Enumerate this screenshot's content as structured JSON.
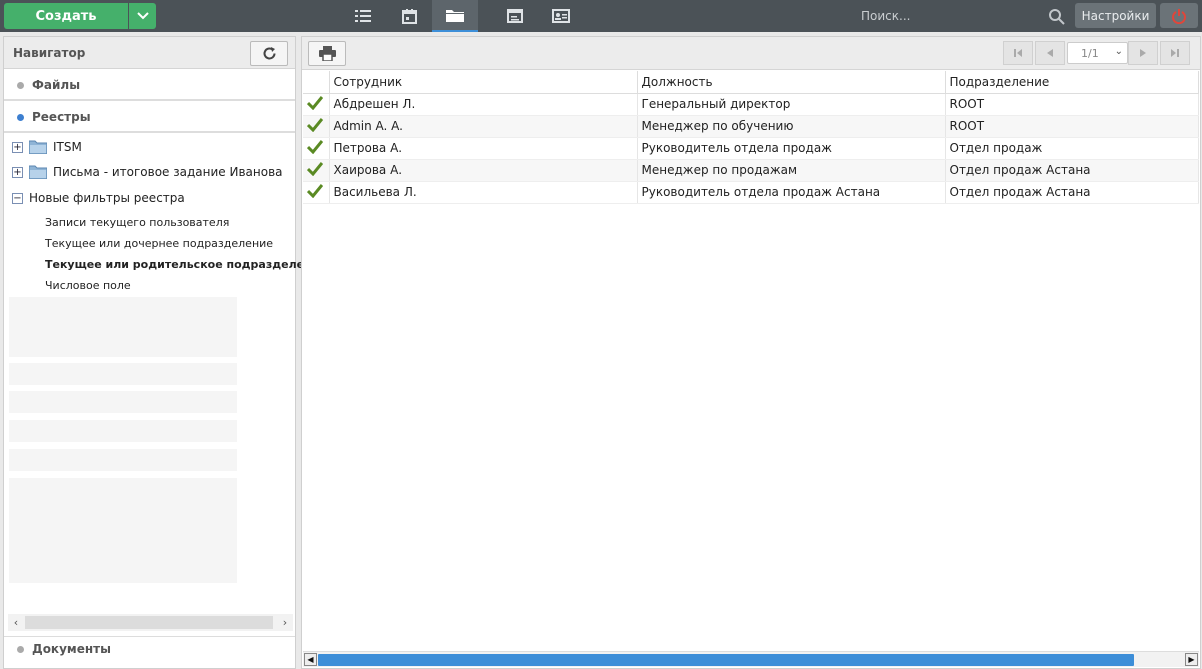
{
  "header": {
    "create_label": "Создать",
    "search_placeholder": "Поиск...",
    "settings_label": "Настройки",
    "icons": [
      "list-icon",
      "calendar-icon",
      "folder-icon",
      "browser-window-icon",
      "contact-card-icon"
    ]
  },
  "navigator": {
    "title": "Навигатор",
    "sections": {
      "files": "Файлы",
      "registries": "Реестры",
      "documents": "Документы"
    },
    "tree": [
      {
        "label": "ITSM"
      },
      {
        "label": "Письма - итоговое задание Иванова"
      },
      {
        "label": "Новые фильтры реестра"
      }
    ],
    "filters": [
      {
        "label": "Записи текущего пользователя"
      },
      {
        "label": "Текущее или дочернее подразделение"
      },
      {
        "label": "Текущее или родительское подразделение"
      },
      {
        "label": "Числовое поле"
      }
    ]
  },
  "pager": {
    "page": "1/1"
  },
  "table": {
    "columns": [
      "Сотрудник",
      "Должность",
      "Подразделение"
    ],
    "rows": [
      {
        "employee": "Абдрешен Л.",
        "position": "Генеральный директор",
        "department": "ROOT"
      },
      {
        "employee": "Admin A. A.",
        "position": "Менеджер по обучению",
        "department": "ROOT"
      },
      {
        "employee": "Петрова А.",
        "position": "Руководитель отдела продаж",
        "department": "Отдел продаж"
      },
      {
        "employee": "Хаирова А.",
        "position": "Менеджер по продажам",
        "department": "Отдел продаж Астана"
      },
      {
        "employee": "Васильева Л.",
        "position": "Руководитель отдела продаж Астана",
        "department": "Отдел продаж Астана"
      }
    ]
  },
  "colors": {
    "create_green": "#45b06b",
    "topbar": "#4b5257",
    "accent_blue": "#3d8ed8",
    "check_green": "#5a8a23"
  }
}
